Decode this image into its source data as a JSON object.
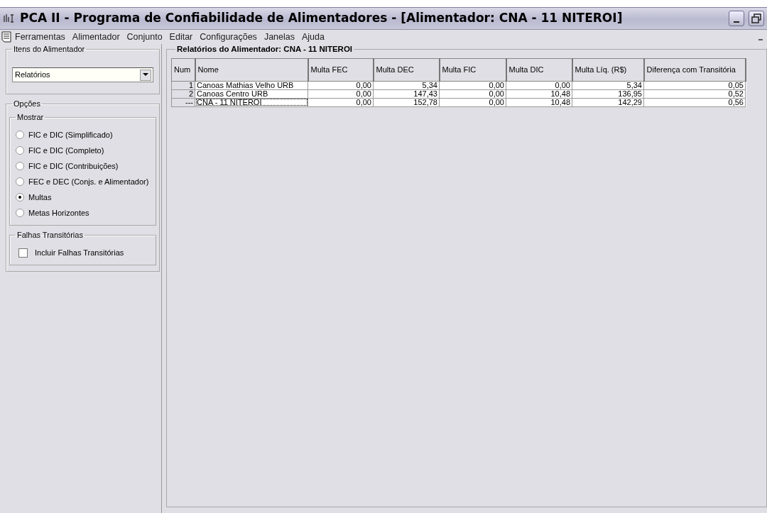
{
  "window": {
    "title": "PCA II - Programa de Confiabilidade de Alimentadores - [Alimentador: CNA - 11 NITEROI]"
  },
  "menu": [
    "Ferramentas",
    "Alimentador",
    "Conjunto",
    "Editar",
    "Configurações",
    "Janelas",
    "Ajuda"
  ],
  "sidebar": {
    "items_group": {
      "title": "Itens do Alimentador",
      "dropdown": {
        "value": "Relatórios"
      }
    },
    "options_group": {
      "title": "Opções",
      "show_group": {
        "title": "Mostrar",
        "options": [
          {
            "label": "FIC e DIC (Simplificado)",
            "selected": false
          },
          {
            "label": "FIC e DIC (Completo)",
            "selected": false
          },
          {
            "label": "FIC e DIC (Contribuições)",
            "selected": false
          },
          {
            "label": "FEC e DEC (Conjs. e Alimentador)",
            "selected": false
          },
          {
            "label": "Multas",
            "selected": true
          },
          {
            "label": "Metas Horizontes",
            "selected": false
          }
        ]
      },
      "transient_group": {
        "title": "Falhas Transitórias",
        "checkbox": {
          "label": "Incluir Falhas Transitórias",
          "checked": false
        }
      }
    }
  },
  "report": {
    "title": "Relatórios do Alimentador: CNA - 11 NITEROI",
    "table": {
      "columns": [
        "Num",
        "Nome",
        "Multa FEC",
        "Multa DEC",
        "Multa FIC",
        "Multa DIC",
        "Multa Líq. (R$)",
        "Diferença com Transitória"
      ],
      "rows": [
        {
          "cells": [
            "1",
            "Canoas Mathias Velho URB",
            "0,00",
            "5,34",
            "0,00",
            "0,00",
            "5,34",
            "0,05"
          ],
          "focused": false
        },
        {
          "cells": [
            "2",
            "Canoas Centro URB",
            "0,00",
            "147,43",
            "0,00",
            "10,48",
            "136,95",
            "0,52"
          ],
          "focused": false
        },
        {
          "cells": [
            "---",
            "CNA - 11 NITEROI",
            "0,00",
            "152,78",
            "0,00",
            "10,48",
            "142,29",
            "0,56"
          ],
          "focused": true
        }
      ]
    }
  }
}
